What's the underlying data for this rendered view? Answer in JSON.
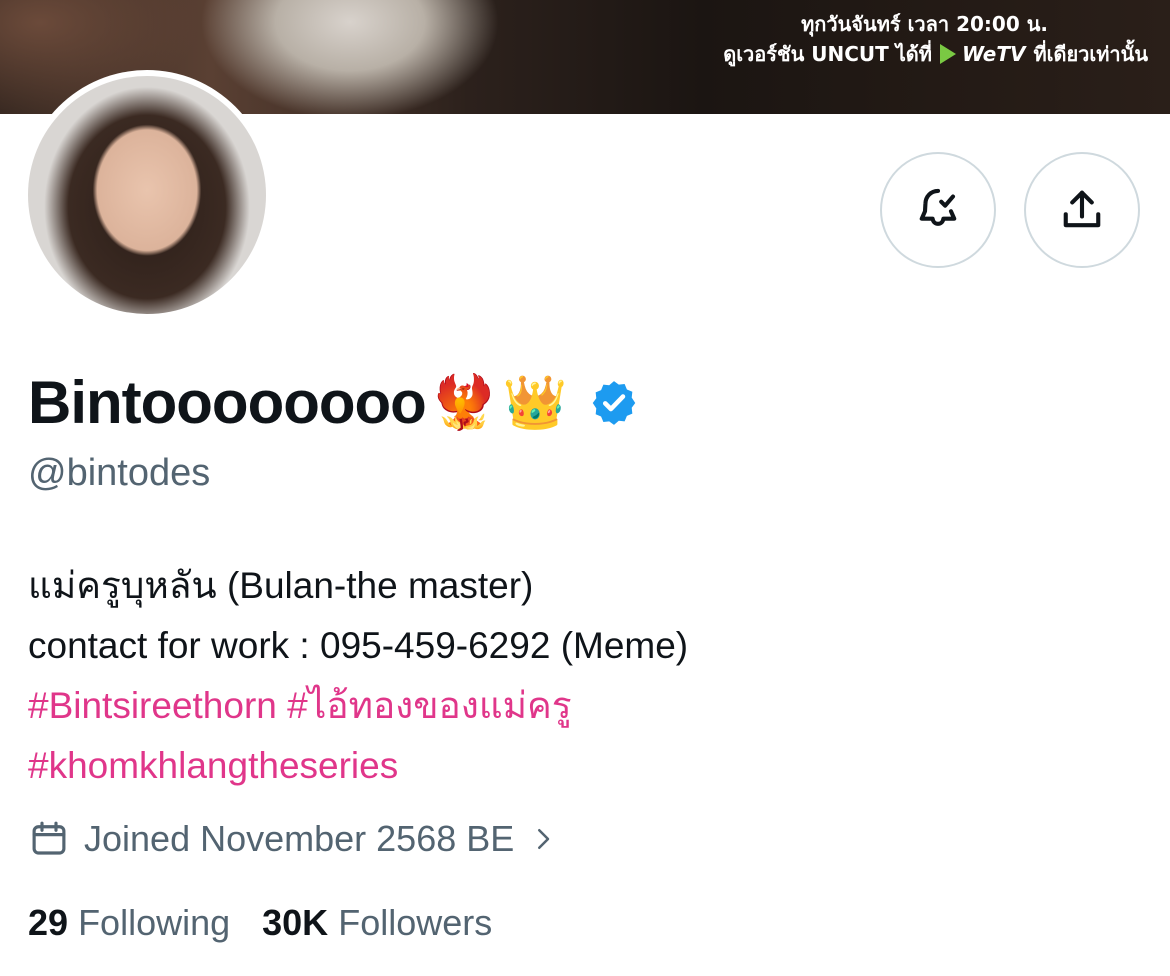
{
  "banner": {
    "line1": "ทุกวันจันทร์ เวลา 20:00 น.",
    "line2_prefix": "ดูเวอร์ชัน UNCUT ได้ที่",
    "brand": "WeTV",
    "line2_suffix": "ที่เดียวเท่านั้น"
  },
  "actions": {
    "notify_icon": "bell-check-icon",
    "share_icon": "share-upload-icon"
  },
  "profile": {
    "display_name": "Bintoooooooo",
    "emoji_1": "🐦‍🔥",
    "emoji_2": "👑",
    "verified_icon": "verified-badge-icon",
    "handle": "@bintodes"
  },
  "bio": {
    "line1": "แม่ครูบุหลัน (Bulan-the master)",
    "line2": "contact for work : 095-459-6292 (Meme)",
    "hashtag1": "#Bintsireethorn",
    "hashtag2": "#ไอ้ทองของแม่ครู",
    "hashtag3": "#khomkhlangtheseries"
  },
  "joined": {
    "icon": "calendar-icon",
    "text": "Joined November 2568 BE"
  },
  "stats": {
    "following_count": "29",
    "following_label": "Following",
    "followers_count": "30K",
    "followers_label": "Followers"
  },
  "colors": {
    "accent_pink": "#e0368a",
    "verified_blue": "#1d9bf0",
    "secondary_text": "#536471"
  }
}
